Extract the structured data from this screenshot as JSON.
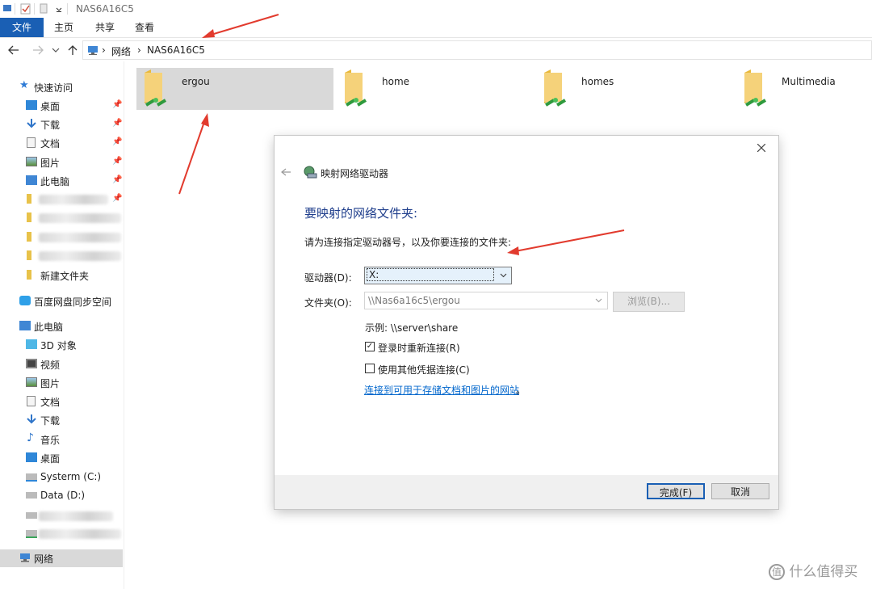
{
  "window": {
    "title": "NAS6A16C5"
  },
  "ribbon": {
    "tabs": [
      "文件",
      "主页",
      "共享",
      "查看"
    ]
  },
  "address": {
    "crumbs": [
      "网络",
      "NAS6A16C5"
    ],
    "separator": "›"
  },
  "sidebar": {
    "quick_access": "快速访问",
    "quick_items": [
      "桌面",
      "下载",
      "文档",
      "图片",
      "此电脑",
      "新建文件夹"
    ],
    "baidu": "百度网盘同步空间",
    "this_pc": "此电脑",
    "pc_items": [
      "3D 对象",
      "视频",
      "图片",
      "文档",
      "下载",
      "音乐",
      "桌面",
      "Systerm (C:)",
      "Data (D:)"
    ],
    "network": "网络"
  },
  "folders": [
    "ergou",
    "home",
    "homes",
    "Multimedia"
  ],
  "dialog": {
    "title": "映射网络驱动器",
    "heading": "要映射的网络文件夹:",
    "instruction": "请为连接指定驱动器号，以及你要连接的文件夹:",
    "drive_label": "驱动器(D):",
    "drive_value": "X:",
    "folder_label": "文件夹(O):",
    "folder_value": "\\\\Nas6a16c5\\ergou",
    "browse": "浏览(B)...",
    "example": "示例: \\\\server\\share",
    "reconnect_label": "登录时重新连接(R)",
    "reconnect_checked": true,
    "other_cred_label": "使用其他凭据连接(C)",
    "other_cred_checked": false,
    "link": "连接到可用于存储文档和图片的网站",
    "link_suffix": "。",
    "finish": "完成(F)",
    "cancel": "取消"
  },
  "watermark": "什么值得买",
  "colors": {
    "accent": "#1a5fb4",
    "heading": "#1f3e8c",
    "link": "#0066cc",
    "arrow": "#e23b2e"
  }
}
